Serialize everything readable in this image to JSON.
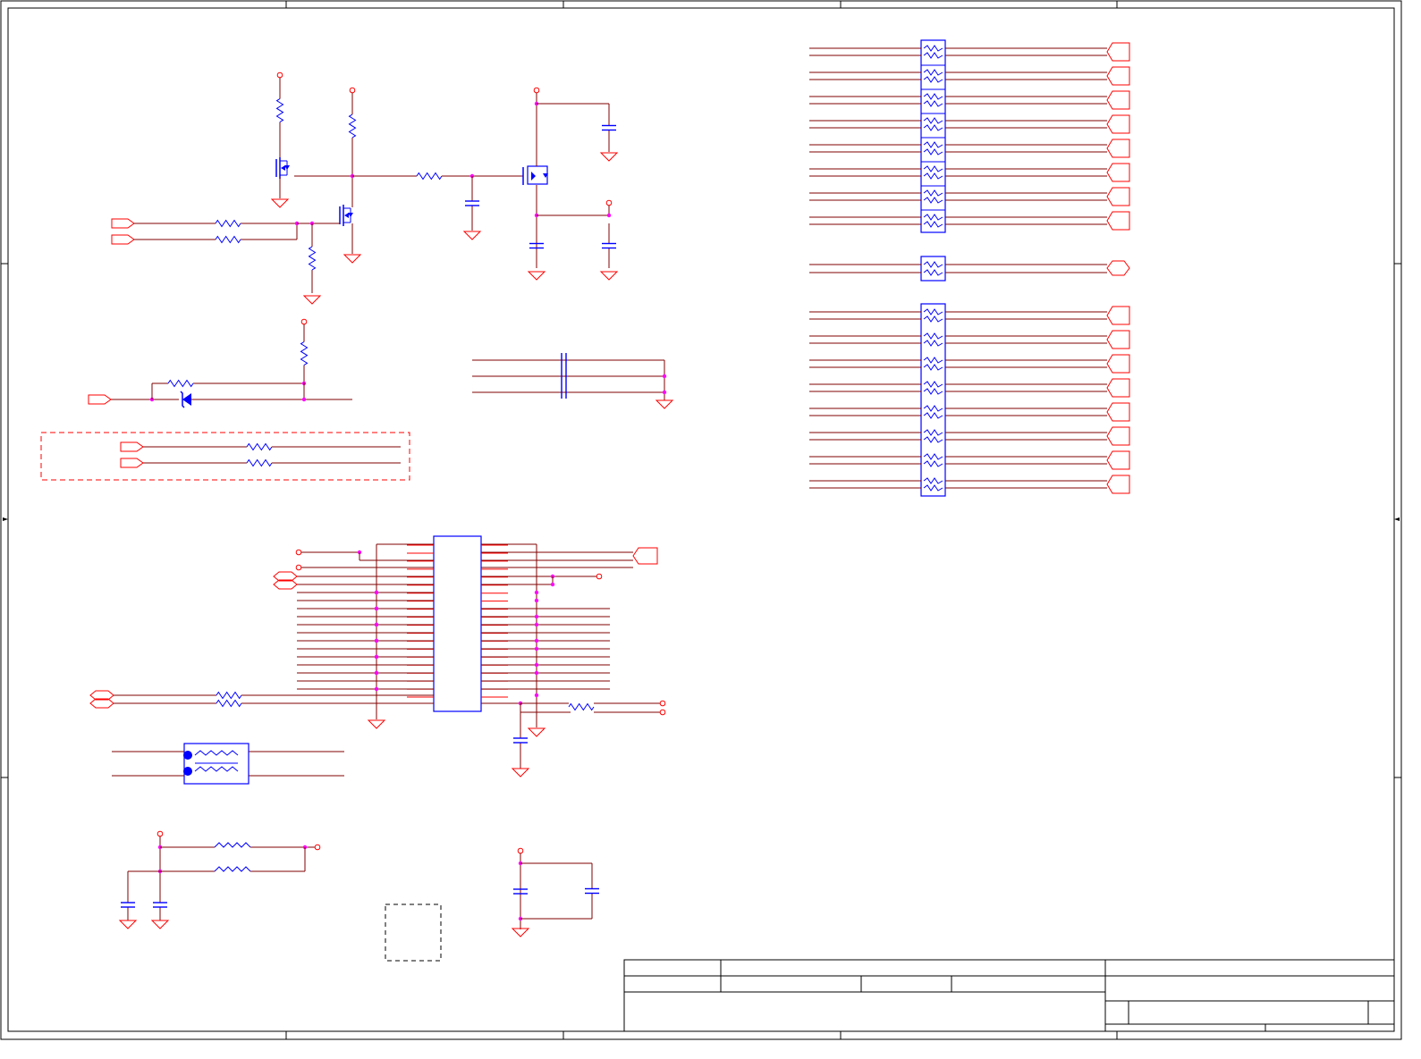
{
  "sheet": {
    "title": "",
    "colors": {
      "border": "#000000",
      "wire": "#800000",
      "pin": "#ff0000",
      "component": "#0000ff",
      "junction": "#ff00ff",
      "keepout": "#ff0000",
      "title_block": "#000000"
    },
    "grid_zones": {
      "columns": 5,
      "rows": 4
    },
    "icons": [
      "resistor-icon",
      "capacitor-icon",
      "ground-icon",
      "power-terminal-icon",
      "offpage-connector-icon",
      "mosfet-icon",
      "zener-diode-icon",
      "inductor-icon",
      "transformer-icon",
      "ic-icon"
    ]
  }
}
